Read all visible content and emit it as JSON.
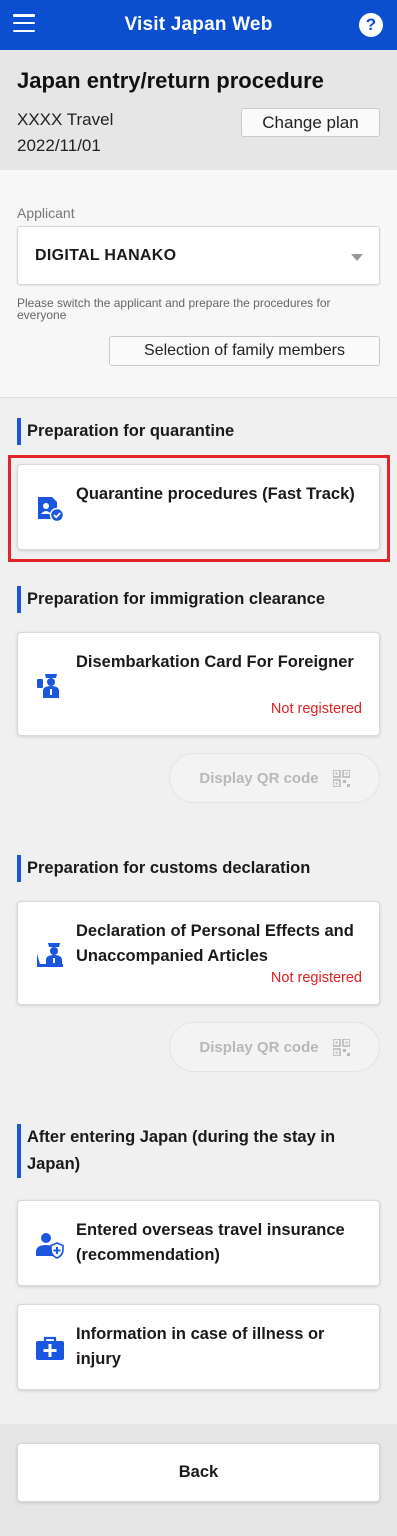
{
  "header": {
    "title": "Visit Japan Web",
    "menu_icon": "hamburger-menu-icon",
    "help_icon": "help-icon",
    "help_glyph": "?",
    "bar_color": "#0b4ecf"
  },
  "plan": {
    "title": "Japan entry/return procedure",
    "travel_name": "XXXX Travel",
    "date": "2022/11/01",
    "change_label": "Change plan"
  },
  "applicant": {
    "label": "Applicant",
    "selected": "DIGITAL HANAKO",
    "note": "Please switch the applicant and prepare the procedures for everyone",
    "family_button": "Selection of family members"
  },
  "sections": [
    {
      "heading": "Preparation for quarantine",
      "cards": [
        {
          "label": "Quarantine procedures (Fast Track)",
          "icon": "quarantine-document-icon",
          "highlighted": true
        }
      ]
    },
    {
      "heading": "Preparation for immigration clearance",
      "cards": [
        {
          "label": "Disembarkation Card For Foreigner",
          "status": "Not registered",
          "icon": "immigration-officer-icon"
        }
      ],
      "qr_button": "Display QR code"
    },
    {
      "heading": "Preparation for customs declaration",
      "cards": [
        {
          "label": "Declaration of Personal Effects and Unaccompanied Articles",
          "status": "Not registered",
          "icon": "customs-officer-icon"
        }
      ],
      "qr_button": "Display QR code"
    },
    {
      "heading": "After entering Japan (during the stay in Japan)",
      "cards": [
        {
          "label": "Entered overseas travel insurance (recommendation)",
          "icon": "insurance-user-shield-icon"
        },
        {
          "label": "Information in case of illness or injury",
          "icon": "medical-kit-icon"
        }
      ]
    }
  ],
  "footer": {
    "back_label": "Back"
  },
  "colors": {
    "accent": "#1a56e0",
    "status_red": "#e02020",
    "highlight_red": "#e3232b"
  }
}
